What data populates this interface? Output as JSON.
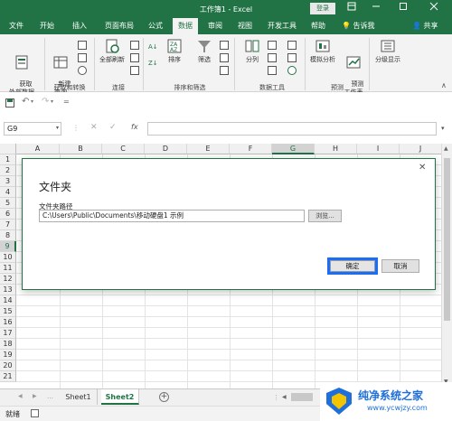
{
  "window": {
    "title": "工作簿1 - Excel",
    "login_label": "登录"
  },
  "tabs": [
    {
      "label": "文件"
    },
    {
      "label": "开始"
    },
    {
      "label": "插入"
    },
    {
      "label": "页面布局"
    },
    {
      "label": "公式"
    },
    {
      "label": "数据"
    },
    {
      "label": "审阅"
    },
    {
      "label": "视图"
    },
    {
      "label": "开发工具"
    },
    {
      "label": "帮助"
    }
  ],
  "tell_me": "告诉我",
  "share": "共享",
  "ribbon": {
    "get_data": "获取\n外部数据",
    "new_query": "新建\n查询",
    "refresh_all": "全部刷新",
    "sort": "排序",
    "filter": "筛选",
    "split": "分列",
    "what_if": "模拟分析",
    "forecast_sheet": "预测\n工作表",
    "outline": "分级显示",
    "groups": {
      "get_transform": "获取和转换",
      "connections": "连接",
      "sort_filter": "排序和筛选",
      "data_tools": "数据工具",
      "forecast": "预测"
    }
  },
  "formula_bar": {
    "name_box": "G9",
    "fx": "fx",
    "formula": ""
  },
  "grid": {
    "columns": [
      "A",
      "B",
      "C",
      "D",
      "E",
      "F",
      "G",
      "H",
      "I",
      "J"
    ],
    "rows": [
      "1",
      "2",
      "3",
      "4",
      "5",
      "6",
      "7",
      "8",
      "9",
      "10",
      "11",
      "12",
      "13",
      "14",
      "15",
      "16",
      "17",
      "18",
      "19",
      "20",
      "21"
    ],
    "selected_column": "G",
    "selected_row": "9"
  },
  "dialog": {
    "title": "文件夹",
    "path_label": "文件夹路径",
    "path_value": "C:\\Users\\Public\\Documents\\移动硬盘1 示例",
    "browse": "浏览...",
    "ok": "确定",
    "cancel": "取消"
  },
  "sheets": [
    {
      "label": "Sheet1"
    },
    {
      "label": "Sheet2"
    }
  ],
  "status": {
    "ready": "就绪"
  },
  "watermark": {
    "brand": "纯净系统之家",
    "url": "www.ycwjzy.com"
  },
  "colors": {
    "excel_green": "#217346",
    "ok_highlight": "#1a6ef5"
  }
}
